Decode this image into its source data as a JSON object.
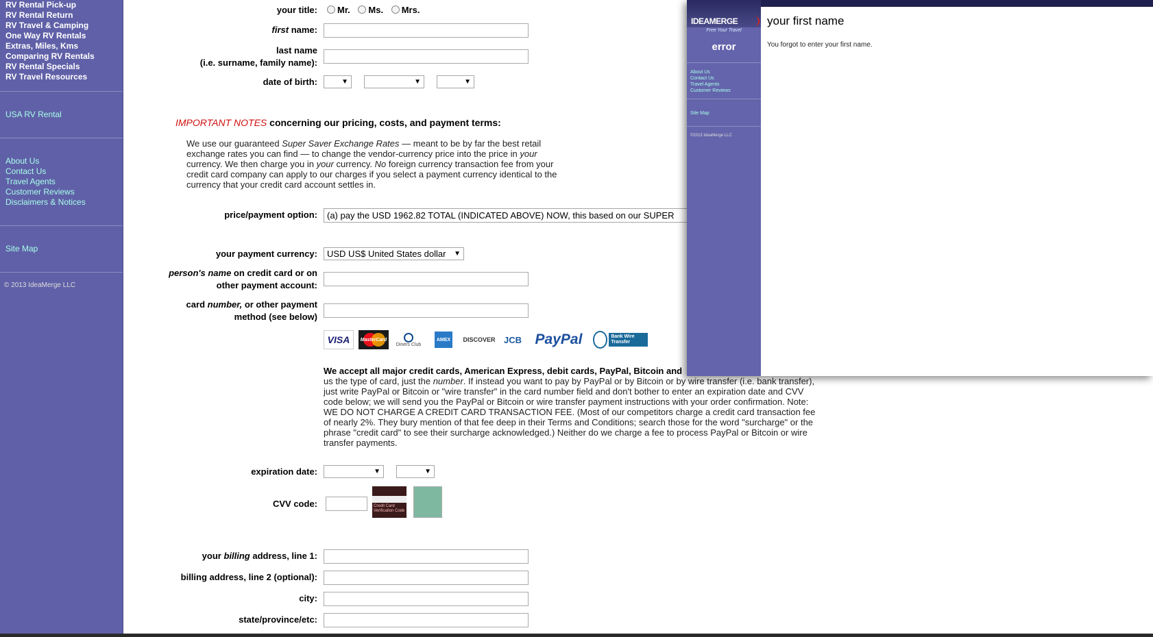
{
  "sidebar": {
    "nav_top": [
      "RV Rental Pick-up",
      "RV Rental Return",
      "RV Travel & Camping",
      "One Way RV Rentals",
      "Extras, Miles, Kms",
      "Comparing RV Rentals",
      "RV Rental Specials",
      "RV Travel Resources"
    ],
    "usa_link": "USA RV Rental",
    "nav_info": [
      "About Us",
      "Contact Us",
      "Travel Agents",
      "Customer Reviews",
      "Disclaimers & Notices"
    ],
    "sitemap": "Site Map",
    "copyright": "© 2013 IdeaMerge LLC"
  },
  "form": {
    "title_label": "your title:",
    "title_options": [
      "Mr.",
      "Ms.",
      "Mrs."
    ],
    "first_name_em": "first",
    "first_name_rest": " name:",
    "last_name_line1": "last name",
    "last_name_line2": "(i.e. surname, family name):",
    "dob_label": "date of birth:",
    "notes_heading_red": "IMPORTANT NOTES",
    "notes_heading_rest": " concerning our pricing, costs, and payment terms:",
    "notes_p1": "We use our guaranteed ",
    "notes_em1": "Super Saver Exchange Rates",
    "notes_p2": " — meant to be by far the best retail exchange rates you can find — to change the vendor-currency price into the price in ",
    "notes_em2": "your",
    "notes_p3": " currency. We then charge you in ",
    "notes_em3": "your",
    "notes_p4": " currency. ",
    "notes_em4": "No",
    "notes_p5": " foreign currency transaction fee from your credit card company can apply to our charges if you select a payment currency identical to the currency that your credit card account settles in.",
    "price_label": "price/payment option:",
    "price_value": "(a) pay the USD 1962.82 TOTAL (INDICATED ABOVE) NOW, this based on our SUPER",
    "currency_label": "your payment currency:",
    "currency_value": "USD US$ United States dollar",
    "name_card_em": "person's name",
    "name_card_rest": " on credit card or on",
    "name_card_line2": "other payment account:",
    "card_number_pre": "card ",
    "card_number_em": "number,",
    "card_number_rest": " or other payment",
    "card_number_line2": "method (see below)",
    "card_logos": [
      "VISA",
      "MasterCard",
      "Diners Club",
      "AMEX",
      "DISCOVER",
      "JCB",
      "PayPal",
      "Bank Wire Transfer"
    ],
    "accept_bold": "We accept all major credit cards, American Express, debit cards, PayPal, Bitcoin and",
    "accept_p1": "us the type of card, just the ",
    "accept_em": "number",
    "accept_p2": ". If instead you want to pay by PayPal or by Bitcoin or by wire transfer (i.e. bank transfer), just write PayPal or Bitcoin or \"wire transfer\" in the card number field and don't bother to enter an expiration date and CVV code below; we will send you the PayPal or Bitcoin or wire transfer payment instructions with your order confirmation. Note: WE DO NOT CHARGE A CREDIT CARD TRANSACTION FEE. (Most of our competitors charge a credit card transaction fee of nearly 2%. They bury mention of that fee deep in their Terms and Conditions; search those for the word \"surcharge\" or the phrase \"credit card\" to see their surcharge acknowledged.) Neither do we charge a fee to process PayPal or Bitcoin or wire transfer payments.",
    "expiration_label": "expiration date:",
    "cvv_label": "CVV code:",
    "cvv_img_text": "Credit Card Verification Code",
    "billing1_pre": "your ",
    "billing1_em": "billing",
    "billing1_rest": " address, line 1:",
    "billing2_label": "billing address, line 2 (optional):",
    "city_label": "city:",
    "state_label": "state/province/etc:"
  },
  "popup": {
    "logo_text": "IDEAMERGE",
    "tagline": "Free Your Travel",
    "side_heading": "error",
    "links": [
      "About Us",
      "Contact Us",
      "Travel Agents",
      "Customer Reviews"
    ],
    "sitemap": "Site Map",
    "copyright": "©2013 IdeaMerge LLC",
    "title": "your first name",
    "message": "You forgot to enter your first name."
  },
  "colors": {
    "sidebar_bg": "#6060a8",
    "link_cyan": "#a8ffe8",
    "notes_red": "#d01010"
  }
}
